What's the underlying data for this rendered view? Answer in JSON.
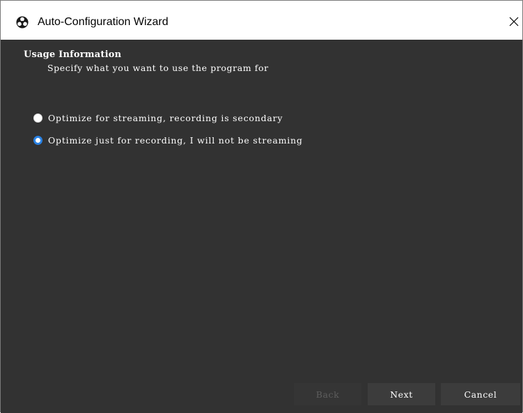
{
  "window": {
    "title": "Auto-Configuration Wizard",
    "app_icon": "obs-logo-icon",
    "close_icon": "close-icon"
  },
  "page": {
    "heading": "Usage Information",
    "subheading": "Specify what you want to use the program for"
  },
  "options": [
    {
      "label": "Optimize for streaming, recording is secondary",
      "selected": false
    },
    {
      "label": "Optimize just for recording, I will not be streaming",
      "selected": true
    }
  ],
  "buttons": {
    "back_label": "Back",
    "back_enabled": false,
    "next_label": "Next",
    "cancel_label": "Cancel"
  },
  "colors": {
    "content_background": "#323232",
    "accent": "#2a82e4",
    "button_background": "#3c3c3c"
  }
}
